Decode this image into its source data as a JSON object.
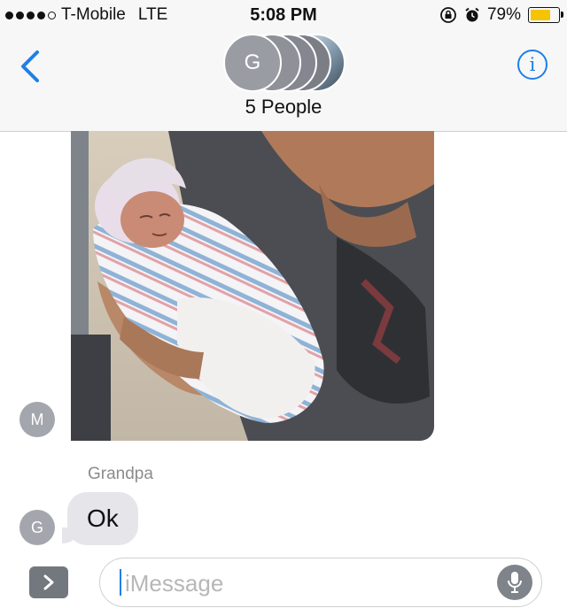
{
  "status_bar": {
    "carrier": "T-Mobile",
    "network": "LTE",
    "time": "5:08 PM",
    "battery": "79%",
    "battery_level": 0.79,
    "signal_bars": 4,
    "signal_total": 5
  },
  "header": {
    "group_initial": "G",
    "group_name": "5 People"
  },
  "thread": {
    "photo_sender_initial": "M",
    "sender_name": "Grandpa",
    "sender_initial": "G",
    "message": "Ok"
  },
  "composer": {
    "placeholder": "iMessage"
  },
  "colors": {
    "accent": "#1f7fe6",
    "bubble_received": "#e6e6ea",
    "battery_fill": "#f5c400"
  }
}
